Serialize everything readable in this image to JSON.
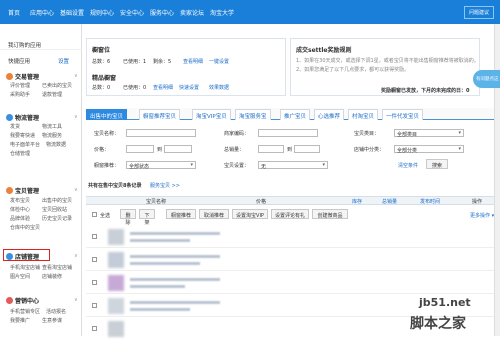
{
  "topnav": {
    "items": [
      "首页",
      "应用中心",
      "基础设置",
      "规则中心",
      "安全中心",
      "服务中心",
      "卖家论坛",
      "淘宝大学"
    ],
    "right": "问题建议"
  },
  "sidebar": {
    "my_apps": "我订购的应用",
    "quick_settings": "快捷应用",
    "settings": "设置",
    "sections": [
      {
        "title": "交易管理",
        "links": [
          "评价管理",
          "已卖出的宝贝",
          "采购助手",
          "退款管理"
        ]
      },
      {
        "title": "物流管理",
        "links": [
          "发货",
          "物流工具",
          "我要寄快递",
          "物流服务",
          "电子面单平台",
          "物流数据",
          "仓储管理"
        ]
      },
      {
        "title": "宝贝管理",
        "links": [
          "发布宝贝",
          "出售中的宝贝",
          "体检中心",
          "宝贝回收站",
          "品牌体验",
          "历史宝贝记录",
          "仓库中的宝贝"
        ]
      },
      {
        "title": "店铺管理",
        "links": [
          "手机淘宝店铺",
          "查看淘宝店铺",
          "图片空间",
          "店铺装修"
        ]
      },
      {
        "title": "营销中心",
        "links": [
          "手机营销专区",
          "活动报名",
          "我要推广",
          "生意参谋"
        ]
      }
    ]
  },
  "summary": {
    "window": {
      "title": "橱窗位",
      "total_label": "总数：6",
      "used_label": "已使用：1",
      "remain_label": "剩余：5",
      "view": "查看明细",
      "setup": "一键设置"
    },
    "featured": {
      "title": "精品橱窗",
      "total_label": "总数：0",
      "used_label": "已使用：0",
      "view": "查看明细",
      "setup": "快速设置",
      "help": "效果数据"
    },
    "reward": {
      "title": "成交settle奖励规则",
      "text1": "1、如果在30天成交，或选择下调1星，或者宝贝将不能出售橱窗推荐将被取消的。",
      "text2": "2、如果您满足了以下几点要求，都可以获得奖励。",
      "link_label": "奖励橱窗已发放，下月的未完成的日：0"
    }
  },
  "tabs": [
    "出售中的宝贝",
    "橱窗推荐宝贝",
    "淘宝VIP宝贝",
    "淘宝服务宝",
    "推广宝贝",
    "心选推荐",
    "村淘宝贝",
    "一件代发宝贝"
  ],
  "filters": {
    "name_label": "宝贝名称：",
    "merchant_code_label": "商家编码：",
    "category_label": "宝贝类目：",
    "category_value": "全部类目",
    "price_label": "价格：",
    "price_to": "到",
    "sales_label": "总销量：",
    "sales_to": "到",
    "shop_cat_label": "店铺中分类：",
    "shop_cat_value": "全部分类",
    "recommend_label": "橱窗推荐：",
    "recommend_value": "全部状态",
    "setting_label": "宝贝设置：",
    "setting_value": "无",
    "clear_label": "清空条件",
    "search_label": "搜索"
  },
  "result": {
    "summary": "共有在售中宝贝8条记录",
    "service": "服务宝贝 >>"
  },
  "table": {
    "headers": [
      "宝贝名称",
      "价格",
      "库存",
      "总销量",
      "发布时间",
      "操作"
    ],
    "select_all": "全选",
    "actions": [
      "删除",
      "下架",
      "橱窗推荐",
      "取消推荐",
      "设置淘宝VIP",
      "设置评论有礼",
      "创建微商品"
    ],
    "more": "更多操作 ▾"
  },
  "float_label": "有问题点这",
  "watermark": {
    "line1": "jb51.net",
    "line2": "脚本之家"
  },
  "colors": {
    "nav": "#1a7fd8",
    "tab_active": "#2d8ae0",
    "link": "#1a6cc8",
    "highlight_box": "#d22"
  }
}
